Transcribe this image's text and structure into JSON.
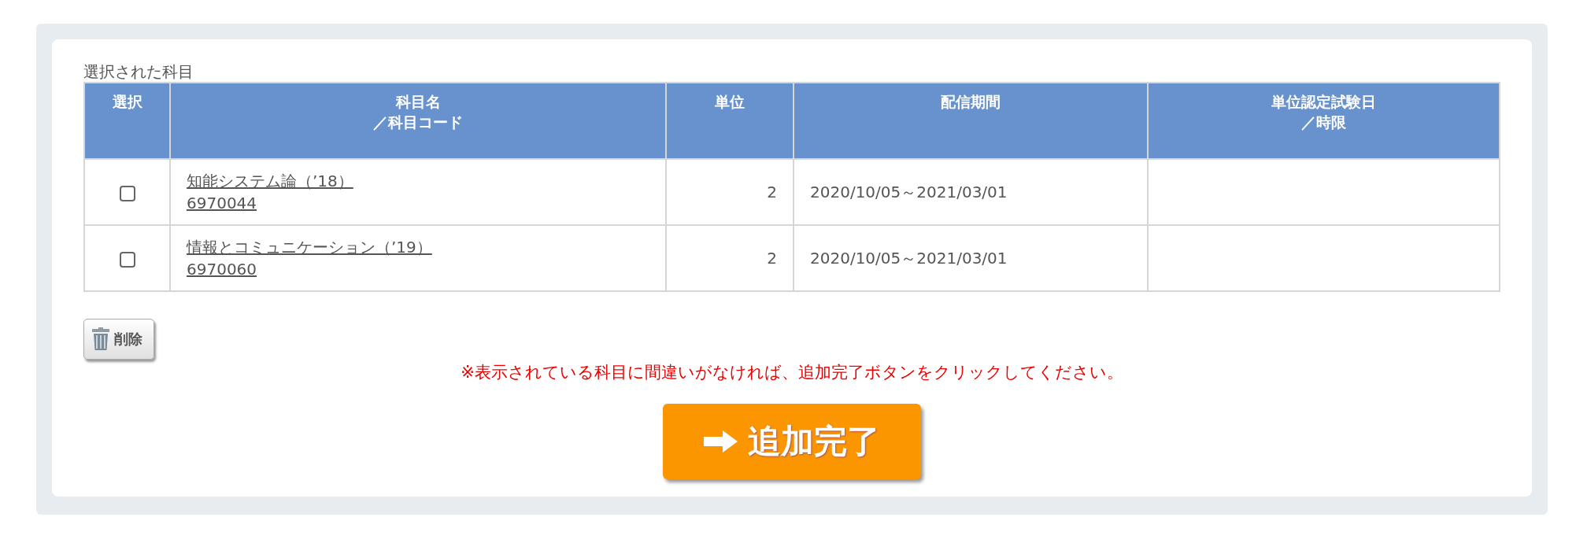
{
  "section_title": "選択された科目",
  "table": {
    "columns": [
      {
        "lines": [
          "選択"
        ]
      },
      {
        "lines": [
          "科目名",
          "／科目コード"
        ]
      },
      {
        "lines": [
          "単位"
        ]
      },
      {
        "lines": [
          "配信期間"
        ]
      },
      {
        "lines": [
          "単位認定試験日",
          "／時限"
        ]
      }
    ],
    "rows": [
      {
        "checked": false,
        "name": "知能システム論（’18）",
        "code": "6970044",
        "units": "2",
        "period": "2020/10/05～2021/03/01"
      },
      {
        "checked": false,
        "name": "情報とコミュニケーション（’19）",
        "code": "6970060",
        "units": "2",
        "period": "2020/10/05～2021/03/01"
      }
    ]
  },
  "delete_button": {
    "label": "削除"
  },
  "notice": "※表示されている科目に間違いがなければ、追加完了ボタンをクリックしてください。",
  "complete_button": {
    "label": "追加完了"
  }
}
